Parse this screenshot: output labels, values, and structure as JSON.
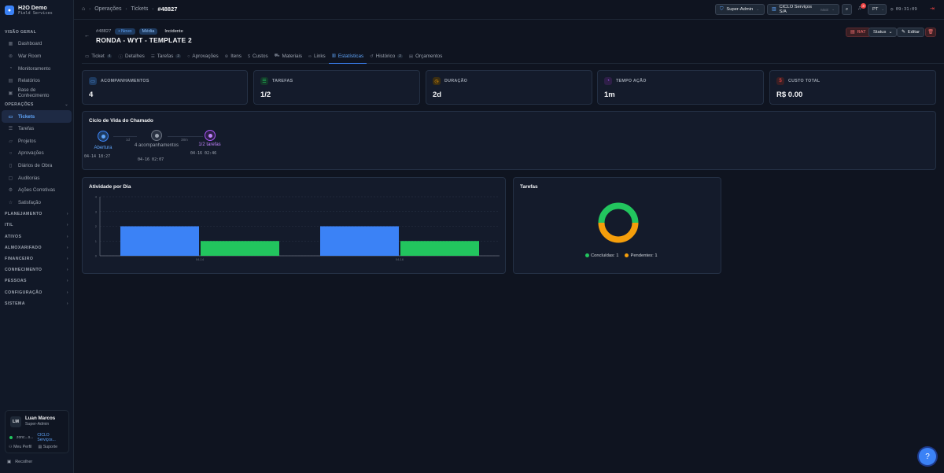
{
  "brand": {
    "name": "H2O Demo",
    "subtitle": "Field Services",
    "logo_icon": "droplet-icon"
  },
  "sidebar": {
    "visao_geral": {
      "title": "VISÃO GERAL",
      "items": [
        {
          "label": "Dashboard",
          "icon": "dashboard-icon"
        },
        {
          "label": "War Room",
          "icon": "radar-icon"
        },
        {
          "label": "Monitoramento",
          "icon": "monitor-icon"
        },
        {
          "label": "Relatórios",
          "icon": "chart-icon"
        },
        {
          "label": "Base de Conhecimento",
          "icon": "book-icon"
        }
      ]
    },
    "operacoes": {
      "title": "OPERAÇÕES",
      "items": [
        {
          "label": "Tickets",
          "icon": "ticket-icon",
          "active": true
        },
        {
          "label": "Tarefas",
          "icon": "checklist-icon"
        },
        {
          "label": "Projetos",
          "icon": "folder-icon"
        },
        {
          "label": "Aprovações",
          "icon": "check-circle-icon"
        },
        {
          "label": "Diários de Obra",
          "icon": "clipboard-icon"
        },
        {
          "label": "Auditorias",
          "icon": "audit-icon"
        },
        {
          "label": "Ações Corretivas",
          "icon": "wrench-icon"
        },
        {
          "label": "Satisfação",
          "icon": "star-icon"
        }
      ]
    },
    "sections": [
      "PLANEJAMENTO",
      "ITIL",
      "ATIVOS",
      "ALMOXARIFADO",
      "FINANCEIRO",
      "CONHECIMENTO",
      "PESSOAS",
      "CONFIGURAÇÃO",
      "SISTEMA"
    ],
    "user": {
      "initials": "LM",
      "name": "Luan Marcos",
      "role": "Super-Admin",
      "email": "zonc...s...",
      "org": "CICLO Serviços...",
      "profile_label": "Meu Perfil",
      "support_label": "Suporte"
    },
    "collapse_label": "Recolher"
  },
  "topbar": {
    "breadcrumb": [
      "Operações",
      "Tickets"
    ],
    "current": "#48827",
    "role_label": "Super-Admin",
    "company_label": "CICLO Serviços S/A",
    "company_tag": "Matri",
    "notifications": "3",
    "lang": "PT",
    "clock": "09:31:09"
  },
  "ticket": {
    "number": "#48827",
    "status": "Novo",
    "priority": "Média",
    "type": "Incidente",
    "title": "RONDA - WYT - TEMPLATE 2",
    "rat_label": "RAT",
    "status_label": "Status",
    "edit_label": "Editar"
  },
  "tabs": [
    {
      "label": "Ticket",
      "icon": "ticket-icon",
      "count": "4"
    },
    {
      "label": "Detalhes",
      "icon": "info-icon"
    },
    {
      "label": "Tarefas",
      "icon": "checklist-icon",
      "count": "2"
    },
    {
      "label": "Aprovações",
      "icon": "check-circle-icon"
    },
    {
      "label": "Itens",
      "icon": "box-icon"
    },
    {
      "label": "Custos",
      "icon": "dollar-icon"
    },
    {
      "label": "Materiais",
      "icon": "cart-icon"
    },
    {
      "label": "Links",
      "icon": "link-icon"
    },
    {
      "label": "Estatísticas",
      "icon": "bar-chart-icon",
      "active": true
    },
    {
      "label": "Histórico",
      "icon": "history-icon",
      "count": "2"
    },
    {
      "label": "Orçamentos",
      "icon": "document-icon"
    }
  ],
  "stats": [
    {
      "label": "ACOMPANHAMENTOS",
      "value": "4",
      "icon": "chat-icon",
      "color": "#3b82f6"
    },
    {
      "label": "TAREFAS",
      "value": "1/2",
      "icon": "checklist-icon",
      "color": "#22c55e"
    },
    {
      "label": "DURAÇÃO",
      "value": "2d",
      "icon": "clock-icon",
      "color": "#f59e0b"
    },
    {
      "label": "TEMPO AÇÃO",
      "value": "1m",
      "icon": "timer-icon",
      "color": "#a855f7"
    },
    {
      "label": "CUSTO TOTAL",
      "value": "R$ 0.00",
      "icon": "dollar-icon",
      "color": "#ef4444"
    }
  ],
  "lifecycle": {
    "title": "Ciclo de Vida do Chamado",
    "steps": [
      {
        "label": "Abertura",
        "time": "04-14 18:27",
        "color": "#3b82f6"
      },
      {
        "label": "4 acompanhamentos",
        "time": "04-16 02:07",
        "color": "#6b7280"
      },
      {
        "label": "1/2 tarefas",
        "time": "04-16 02:46",
        "color": "#a855f7"
      }
    ],
    "durations": [
      "1d",
      "38m"
    ]
  },
  "activity_chart": {
    "title": "Atividade por Dia"
  },
  "tasks_chart": {
    "title": "Tarefas",
    "legend": [
      "Concluídas: 1",
      "Pendentes: 1"
    ]
  },
  "chart_data": [
    {
      "type": "bar",
      "title": "Atividade por Dia",
      "categories": [
        "04-14",
        "04-16"
      ],
      "series": [
        {
          "values": [
            2,
            2
          ],
          "color": "#3b82f6"
        },
        {
          "values": [
            1,
            1
          ],
          "color": "#22c55e"
        }
      ],
      "yticks": [
        "0",
        "1",
        "2",
        "3",
        "4"
      ],
      "ylim": [
        0,
        4
      ],
      "grid": true
    },
    {
      "type": "pie",
      "title": "Tarefas",
      "slices": [
        {
          "label": "Concluídas",
          "value": 1,
          "color": "#22c55e"
        },
        {
          "label": "Pendentes",
          "value": 1,
          "color": "#f59e0b"
        }
      ]
    }
  ]
}
